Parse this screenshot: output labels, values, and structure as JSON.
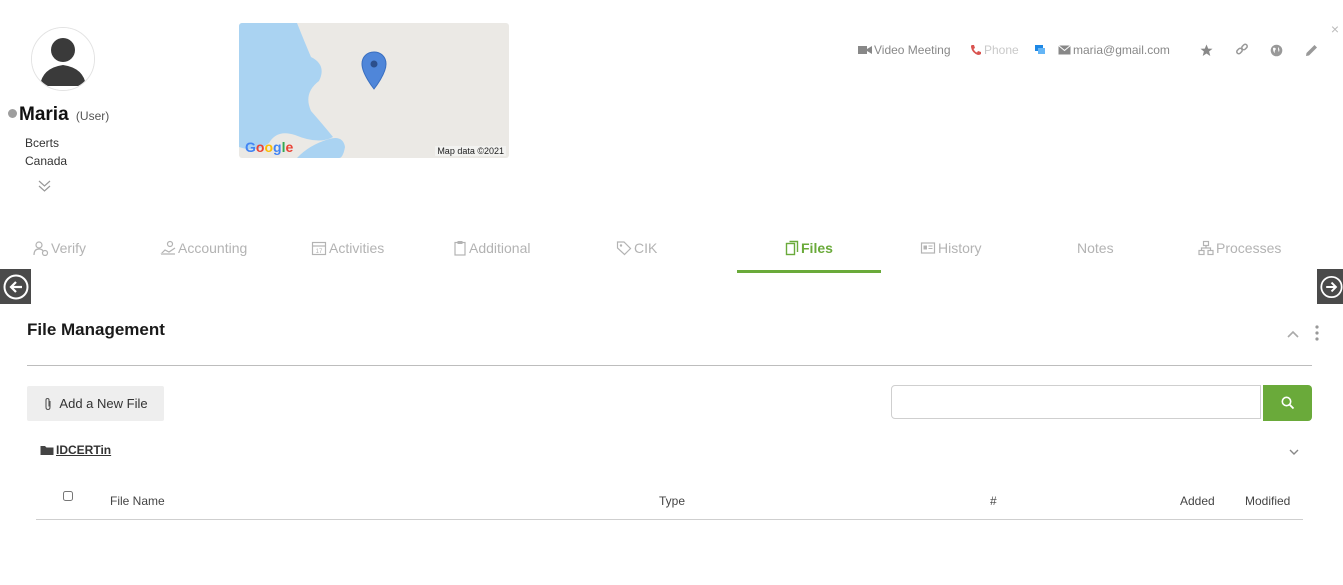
{
  "profile": {
    "name": "Maria",
    "role": "(User)",
    "company": "Bcerts",
    "country": "Canada",
    "status_color": "#9e9e9e"
  },
  "map": {
    "credit": "Map data ©2021",
    "logo": "Google"
  },
  "actions": {
    "video_meeting": "Video Meeting",
    "phone": "Phone",
    "email": "maria@gmail.com"
  },
  "tabs": [
    {
      "label": "Verify",
      "icon": "verify-icon"
    },
    {
      "label": "Accounting",
      "icon": "accounting-icon"
    },
    {
      "label": "Activities",
      "icon": "calendar-icon"
    },
    {
      "label": "Additional",
      "icon": "clipboard-icon"
    },
    {
      "label": "CIK",
      "icon": "tag-icon"
    },
    {
      "label": "Files",
      "icon": "files-icon",
      "active": true
    },
    {
      "label": "History",
      "icon": "history-icon"
    },
    {
      "label": "Notes",
      "icon": ""
    },
    {
      "label": "Processes",
      "icon": "processes-icon"
    }
  ],
  "section": {
    "title": "File Management",
    "add_button": "Add a New File",
    "search_placeholder": "",
    "folder_name": "IDCERTin"
  },
  "table": {
    "headers": [
      "File Name",
      "Type",
      "#",
      "Added",
      "Modified"
    ]
  },
  "colors": {
    "accent": "#6aaa3a",
    "tab_inactive": "#b3b3b3",
    "nav_arrow": "#4a4a4a"
  }
}
